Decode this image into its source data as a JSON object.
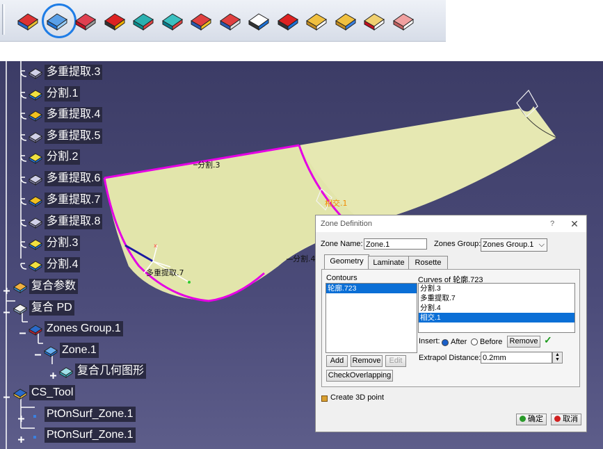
{
  "toolbar": {
    "icons": [
      "stacking-cube-icon",
      "zone-definition-icon",
      "red-slab-icon",
      "split-arrow-icon",
      "green-surface-icon",
      "teal-surface-icon",
      "scan-extract-icon",
      "flag-extract-icon",
      "transfer-white-icon",
      "transfer-red-icon",
      "ply-stack-icon",
      "ply-stack-blue-icon",
      "red-wedge-icon",
      "pink-layers-icon"
    ],
    "active_icon_index": 1
  },
  "tree": {
    "items": [
      {
        "label": "多重提取.3",
        "icon": "multi-extract-icon"
      },
      {
        "label": "分割.1",
        "icon": "split-icon"
      },
      {
        "label": "多重提取.4",
        "icon": "multi-extract-flag-icon"
      },
      {
        "label": "多重提取.5",
        "icon": "multi-extract-icon"
      },
      {
        "label": "分割.2",
        "icon": "split-icon"
      },
      {
        "label": "多重提取.6",
        "icon": "multi-extract-icon"
      },
      {
        "label": "多重提取.7",
        "icon": "multi-extract-flag-icon"
      },
      {
        "label": "多重提取.8",
        "icon": "multi-extract-icon"
      },
      {
        "label": "分割.3",
        "icon": "split-icon"
      },
      {
        "label": "分割.4",
        "icon": "split-icon"
      },
      {
        "label": "复合参数",
        "icon": "composites-parameters-icon"
      },
      {
        "label": "复合 PD",
        "icon": "composites-pd-icon"
      },
      {
        "label": "Zones Group.1",
        "icon": "zones-group-icon"
      },
      {
        "label": "Zone.1",
        "icon": "zone-icon"
      },
      {
        "label": "复合几何图形",
        "icon": "composite-geometry-icon"
      },
      {
        "label": "CS_Tool",
        "icon": "cs-tool-icon"
      },
      {
        "label": "PtOnSurf_Zone.1",
        "icon": "point-icon"
      },
      {
        "label": "PtOnSurf_Zone.1",
        "icon": "point-icon"
      }
    ]
  },
  "viewport": {
    "labels": {
      "split3": "分割.3",
      "intersect1": "相交.1",
      "split4": "分割.4",
      "extract7": "多重提取.7"
    },
    "colors": {
      "surface": "#e8eab6",
      "boundary": "#e400e4",
      "background": "#454573"
    }
  },
  "dialog": {
    "title": "Zone Definition",
    "help": "?",
    "close": "✕",
    "zone_name_label": "Zone Name:",
    "zone_name_value": "Zone.1",
    "zones_group_label": "Zones Group:",
    "zones_group_value": "Zones Group.1",
    "tabs": [
      "Geometry",
      "Laminate",
      "Rosette"
    ],
    "active_tab": "Geometry",
    "contours_label": "Contours",
    "contours": [
      "轮廓.723"
    ],
    "curves_label": "Curves of 轮廓.723",
    "curves": [
      "分割.3",
      "多重提取.7",
      "分割.4",
      "相交.1"
    ],
    "selected_curve_index": 3,
    "add_label": "Add",
    "remove_label": "Remove",
    "edit_label": "Edit",
    "check_label": "CheckOverlapping",
    "insert_label": "Insert:",
    "after_label": "After",
    "before_label": "Before",
    "insert_remove_label": "Remove",
    "insert_mode": "After",
    "extrapol_label": "Extrapol Distance:",
    "extrapol_value": "0.2mm",
    "create_point_label": "Create 3D point",
    "ok_label": "确定",
    "cancel_label": "取消"
  }
}
